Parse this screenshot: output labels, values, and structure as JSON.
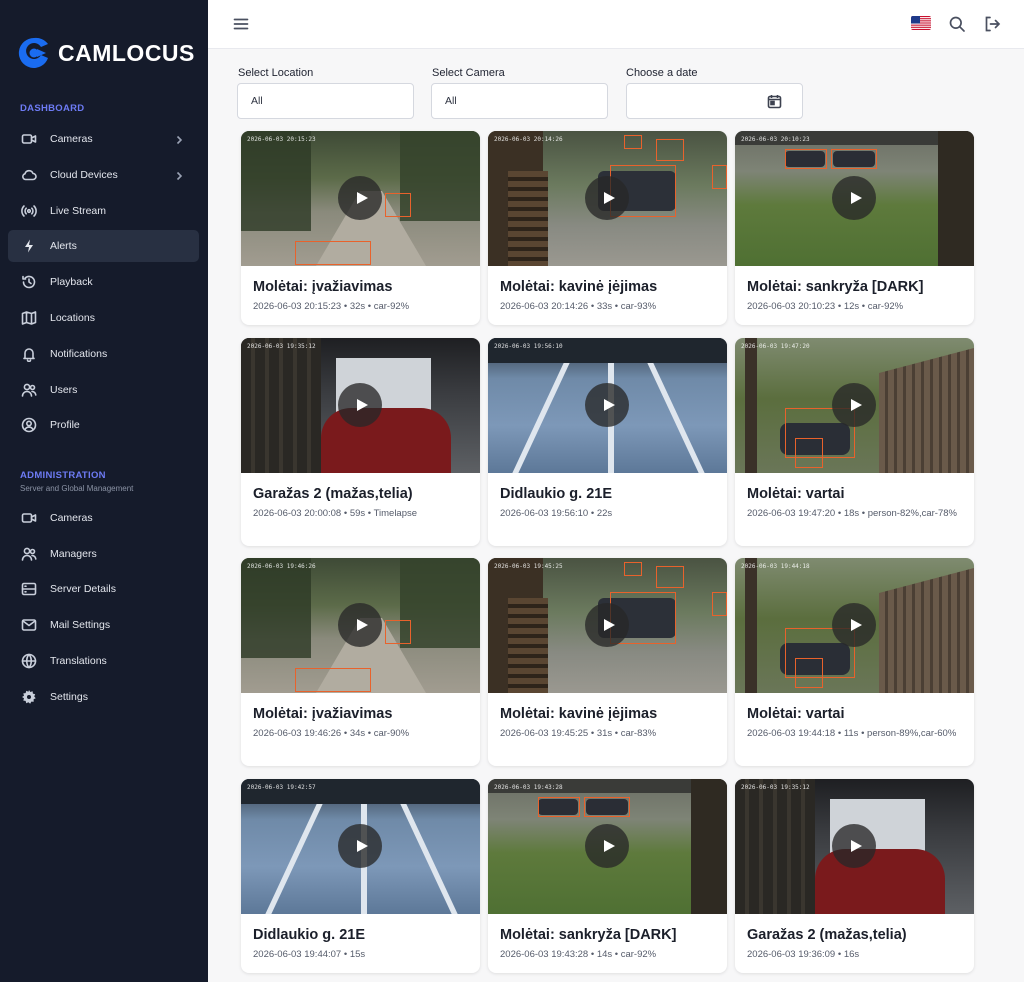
{
  "app": {
    "brand": "CAMLOCUS",
    "brand_color": "#1a6cf0",
    "accent_color": "#6d7bf4"
  },
  "sidebar": {
    "dashboard_title": "DASHBOARD",
    "dashboard_items": [
      {
        "label": "Cameras",
        "icon": "video-camera-icon",
        "chevron": true
      },
      {
        "label": "Cloud Devices",
        "icon": "cloud-icon",
        "chevron": true
      },
      {
        "label": "Live Stream",
        "icon": "broadcast-icon",
        "chevron": false
      },
      {
        "label": "Alerts",
        "icon": "lightning-icon",
        "chevron": false,
        "active": true
      },
      {
        "label": "Playback",
        "icon": "history-icon",
        "chevron": false
      },
      {
        "label": "Locations",
        "icon": "map-icon",
        "chevron": false
      },
      {
        "label": "Notifications",
        "icon": "bell-icon",
        "chevron": false
      },
      {
        "label": "Users",
        "icon": "users-icon",
        "chevron": false
      },
      {
        "label": "Profile",
        "icon": "user-circle-icon",
        "chevron": false
      }
    ],
    "admin_title": "ADMINISTRATION",
    "admin_subtitle": "Server and Global Management",
    "admin_items": [
      {
        "label": "Cameras",
        "icon": "video-camera-icon"
      },
      {
        "label": "Managers",
        "icon": "users-icon"
      },
      {
        "label": "Server Details",
        "icon": "server-icon"
      },
      {
        "label": "Mail Settings",
        "icon": "mail-icon"
      },
      {
        "label": "Translations",
        "icon": "globe-icon"
      },
      {
        "label": "Settings",
        "icon": "gear-icon"
      }
    ]
  },
  "topbar": {
    "menu_icon": "hamburger-icon",
    "flag_icon": "us-flag-icon",
    "search_icon": "search-icon",
    "logout_icon": "logout-icon"
  },
  "filters": {
    "location_label": "Select Location",
    "location_value": "All",
    "camera_label": "Select Camera",
    "camera_value": "All",
    "date_label": "Choose a date",
    "date_value": ""
  },
  "alerts": [
    {
      "title": "Molėtai: įvažiavimas",
      "meta": "2026-06-03 20:15:23 • 32s • car-92%",
      "stamp": "2026-06-03 20:15:23",
      "scene": "driveway"
    },
    {
      "title": "Molėtai: kavinė įėjimas",
      "meta": "2026-06-03 20:14:26 • 33s • car-93%",
      "stamp": "2026-06-03 20:14:26",
      "scene": "cafe"
    },
    {
      "title": "Molėtai: sankryža [DARK]",
      "meta": "2026-06-03 20:10:23 • 12s • car-92%",
      "stamp": "2026-06-03 20:10:23",
      "scene": "crossroad"
    },
    {
      "title": "Garažas 2 (mažas,telia)",
      "meta": "2026-06-03 20:00:08 • 59s • Timelapse",
      "stamp": "2026-06-03 19:35:12",
      "scene": "garage"
    },
    {
      "title": "Didlaukio g. 21E",
      "meta": "2026-06-03 19:56:10 • 22s",
      "stamp": "2026-06-03 19:56:10",
      "scene": "parking"
    },
    {
      "title": "Molėtai: vartai",
      "meta": "2026-06-03 19:47:20 • 18s • person-82%,car-78%",
      "stamp": "2026-06-03 19:47:20",
      "scene": "gate"
    },
    {
      "title": "Molėtai: įvažiavimas",
      "meta": "2026-06-03 19:46:26 • 34s • car-90%",
      "stamp": "2026-06-03 19:46:26",
      "scene": "driveway"
    },
    {
      "title": "Molėtai: kavinė įėjimas",
      "meta": "2026-06-03 19:45:25 • 31s • car-83%",
      "stamp": "2026-06-03 19:45:25",
      "scene": "cafe"
    },
    {
      "title": "Molėtai: vartai",
      "meta": "2026-06-03 19:44:18 • 11s • person-89%,car-60%",
      "stamp": "2026-06-03 19:44:18",
      "scene": "gate"
    },
    {
      "title": "Didlaukio g. 21E",
      "meta": "2026-06-03 19:44:07 • 15s",
      "stamp": "2026-06-03 19:42:57",
      "scene": "parking"
    },
    {
      "title": "Molėtai: sankryža [DARK]",
      "meta": "2026-06-03 19:43:28 • 14s • car-92%",
      "stamp": "2026-06-03 19:43:28",
      "scene": "crossroad"
    },
    {
      "title": "Garažas 2 (mažas,telia)",
      "meta": "2026-06-03 19:36:09 • 16s",
      "stamp": "2026-06-03 19:35:12",
      "scene": "garage"
    }
  ]
}
